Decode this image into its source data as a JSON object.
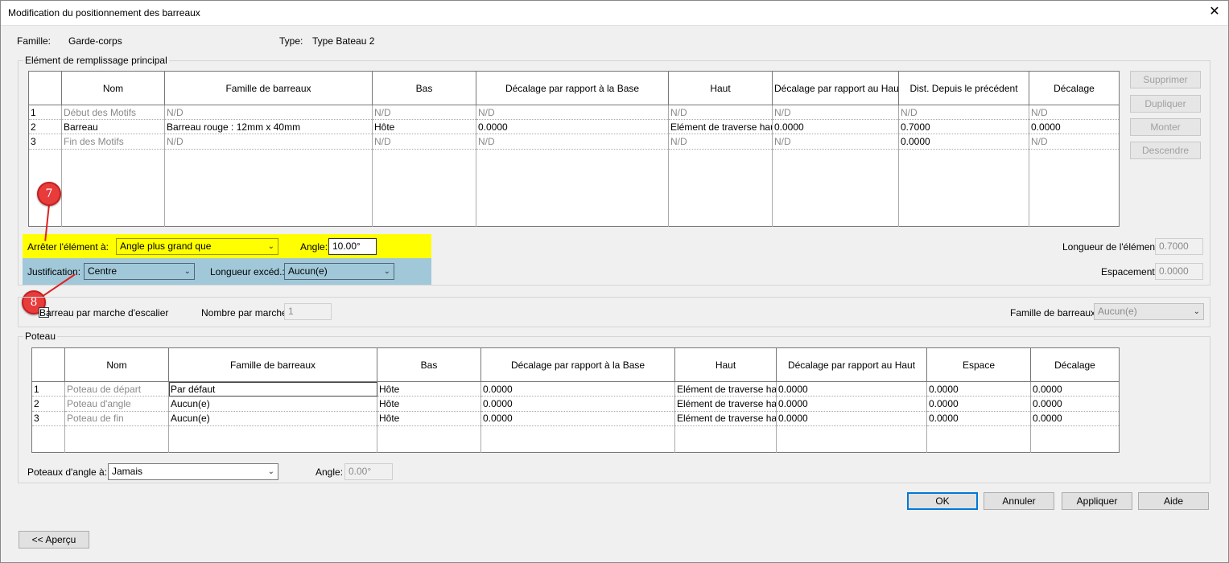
{
  "window": {
    "title": "Modification du positionnement des barreaux",
    "close_glyph": "✕"
  },
  "header": {
    "family_label": "Famille:",
    "family_value": "Garde-corps",
    "type_label": "Type:",
    "type_value": "Type Bateau 2"
  },
  "main_pattern": {
    "group_title": "Elément de remplissage principal",
    "columns": [
      "Nom",
      "Famille de barreaux",
      "Bas",
      "Décalage par rapport à la Base",
      "Haut",
      "Décalage par rapport au Haut",
      "Dist. Depuis le précédent",
      "Décalage"
    ],
    "rows": [
      {
        "num": "1",
        "cells": [
          "Début des Motifs",
          "N/D",
          "N/D",
          "N/D",
          "N/D",
          "N/D",
          "N/D",
          "N/D"
        ]
      },
      {
        "num": "2",
        "cells": [
          "Barreau",
          "Barreau rouge : 12mm x 40mm",
          "Hôte",
          "0.0000",
          "Elément de traverse haut",
          "0.0000",
          "0.7000",
          "0.0000"
        ]
      },
      {
        "num": "3",
        "cells": [
          "Fin des Motifs",
          "N/D",
          "N/D",
          "N/D",
          "N/D",
          "N/D",
          "0.0000",
          "N/D"
        ]
      }
    ],
    "side_buttons": [
      "Supprimer",
      "Dupliquer",
      "Monter",
      "Descendre"
    ],
    "break_label": "Arrêter l'élément à:",
    "break_value": "Angle plus grand que",
    "angle_label": "Angle:",
    "angle_value": "10.00°",
    "justification_label": "Justification:",
    "justification_value": "Centre",
    "excess_label": "Longueur excéd.:",
    "excess_value": "Aucun(e)",
    "length_label": "Longueur de l'élément:",
    "length_value": "0.7000",
    "spacing_label": "Espacement:",
    "spacing_value": "0.0000"
  },
  "stair": {
    "checkbox_label": "Barreau par marche d'escalier",
    "per_tread_label": "Nombre par marche:",
    "per_tread_value": "1",
    "family_label": "Famille de barreaux:",
    "family_value": "Aucun(e)"
  },
  "posts": {
    "group_title": "Poteau",
    "columns": [
      "Nom",
      "Famille de barreaux",
      "Bas",
      "Décalage par rapport à la Base",
      "Haut",
      "Décalage par rapport au Haut",
      "Espace",
      "Décalage"
    ],
    "rows": [
      {
        "num": "1",
        "cells": [
          "Poteau de départ",
          "Par défaut",
          "Hôte",
          "0.0000",
          "Elément de traverse ha",
          "0.0000",
          "0.0000",
          "0.0000"
        ]
      },
      {
        "num": "2",
        "cells": [
          "Poteau d'angle",
          "Aucun(e)",
          "Hôte",
          "0.0000",
          "Elément de traverse ha",
          "0.0000",
          "0.0000",
          "0.0000"
        ]
      },
      {
        "num": "3",
        "cells": [
          "Poteau de fin",
          "Aucun(e)",
          "Hôte",
          "0.0000",
          "Elément de traverse ha",
          "0.0000",
          "0.0000",
          "0.0000"
        ]
      }
    ],
    "corner_label": "Poteaux d'angle à:",
    "corner_value": "Jamais",
    "angle_label": "Angle:",
    "angle_value": "0.00°"
  },
  "footer": {
    "ok": "OK",
    "cancel": "Annuler",
    "apply": "Appliquer",
    "help": "Aide",
    "preview": "<< Aperçu"
  },
  "annotations": {
    "marker_7": "7",
    "marker_8": "8",
    "highlight_colors": {
      "yellow": "#ffff00",
      "blue": "#a0c8d9",
      "marker": "#e83b3b"
    }
  }
}
